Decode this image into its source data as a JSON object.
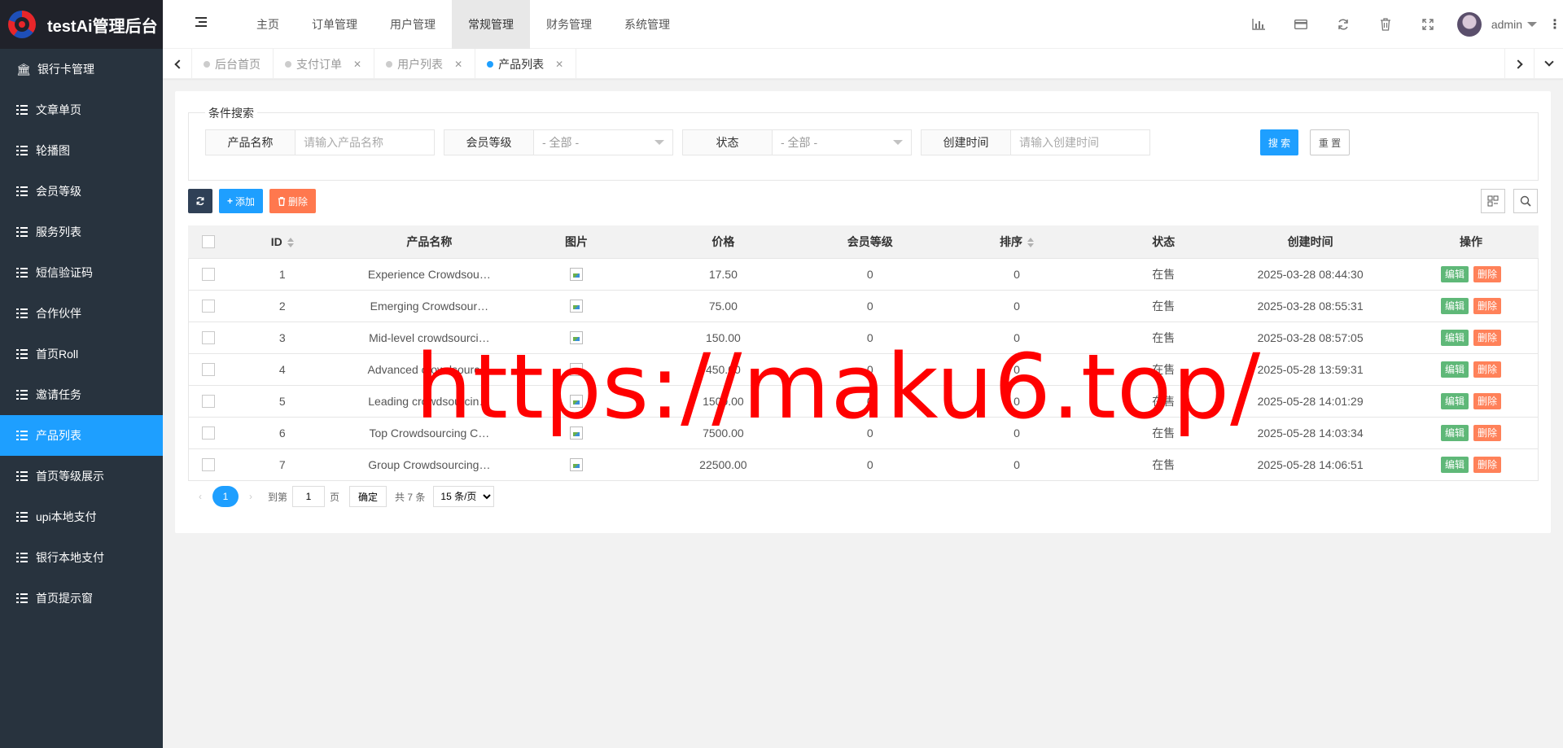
{
  "app": {
    "title": "testAi管理后台"
  },
  "sidebar": {
    "items": [
      {
        "label": "银行卡管理",
        "icon": "bank-icon"
      },
      {
        "label": "文章单页",
        "icon": "list-icon"
      },
      {
        "label": "轮播图",
        "icon": "list-icon"
      },
      {
        "label": "会员等级",
        "icon": "list-icon"
      },
      {
        "label": "服务列表",
        "icon": "list-icon"
      },
      {
        "label": "短信验证码",
        "icon": "list-icon"
      },
      {
        "label": "合作伙伴",
        "icon": "list-icon"
      },
      {
        "label": "首页Roll",
        "icon": "list-icon"
      },
      {
        "label": "邀请任务",
        "icon": "list-icon"
      },
      {
        "label": "产品列表",
        "icon": "list-icon",
        "active": true
      },
      {
        "label": "首页等级展示",
        "icon": "list-icon"
      },
      {
        "label": "upi本地支付",
        "icon": "list-icon"
      },
      {
        "label": "银行本地支付",
        "icon": "list-icon"
      },
      {
        "label": "首页提示窗",
        "icon": "list-icon"
      }
    ]
  },
  "header": {
    "nav": [
      "主页",
      "订单管理",
      "用户管理",
      "常规管理",
      "财务管理",
      "系统管理"
    ],
    "active_nav": "常规管理",
    "user": "admin"
  },
  "tabs": [
    {
      "label": "后台首页",
      "closable": false
    },
    {
      "label": "支付订单",
      "closable": true
    },
    {
      "label": "用户列表",
      "closable": true
    },
    {
      "label": "产品列表",
      "closable": true,
      "active": true
    }
  ],
  "search": {
    "legend": "条件搜索",
    "product_name_label": "产品名称",
    "product_name_placeholder": "请输入产品名称",
    "level_label": "会员等级",
    "level_value": "- 全部 -",
    "status_label": "状态",
    "status_value": "- 全部 -",
    "created_label": "创建时间",
    "created_placeholder": "请输入创建时间",
    "search_btn": "搜 索",
    "reset_btn": "重 置"
  },
  "toolbar": {
    "add": "添加",
    "delete": "删除"
  },
  "table": {
    "columns": [
      "ID",
      "产品名称",
      "图片",
      "价格",
      "会员等级",
      "排序",
      "状态",
      "创建时间",
      "操作"
    ],
    "edit_label": "编辑",
    "delete_label": "删除",
    "rows": [
      {
        "id": "1",
        "name": "Experience Crowdsou…",
        "price": "17.50",
        "level": "0",
        "sort": "0",
        "status": "在售",
        "created": "2025-03-28 08:44:30"
      },
      {
        "id": "2",
        "name": "Emerging Crowdsour…",
        "price": "75.00",
        "level": "0",
        "sort": "0",
        "status": "在售",
        "created": "2025-03-28 08:55:31"
      },
      {
        "id": "3",
        "name": "Mid-level crowdsourci…",
        "price": "150.00",
        "level": "0",
        "sort": "0",
        "status": "在售",
        "created": "2025-03-28 08:57:05"
      },
      {
        "id": "4",
        "name": "Advanced crowdsourc…",
        "price": "450.00",
        "level": "0",
        "sort": "0",
        "status": "在售",
        "created": "2025-05-28 13:59:31"
      },
      {
        "id": "5",
        "name": "Leading crowdsourcin…",
        "price": "1500.00",
        "level": "0",
        "sort": "0",
        "status": "在售",
        "created": "2025-05-28 14:01:29"
      },
      {
        "id": "6",
        "name": "Top Crowdsourcing C…",
        "price": "7500.00",
        "level": "0",
        "sort": "0",
        "status": "在售",
        "created": "2025-05-28 14:03:34"
      },
      {
        "id": "7",
        "name": "Group Crowdsourcing…",
        "price": "22500.00",
        "level": "0",
        "sort": "0",
        "status": "在售",
        "created": "2025-05-28 14:06:51"
      }
    ]
  },
  "pager": {
    "current": "1",
    "goto_label": "到第",
    "goto_value": "1",
    "page_unit": "页",
    "confirm": "确定",
    "total": "共 7 条",
    "per_page": "15 条/页"
  },
  "watermark": "https://maku6.top/"
}
